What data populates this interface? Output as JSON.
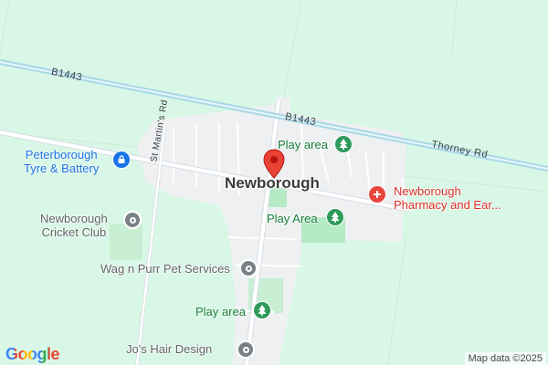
{
  "map": {
    "town_label": "Newborough",
    "roads": {
      "b1443_west": "B1443",
      "b1443_east": "B1443",
      "thorney_rd": "Thorney Rd",
      "st_martins_rd": "St Martin's Rd"
    },
    "pois": {
      "tyre": {
        "line1": "Peterborough",
        "line2": "Tyre & Battery",
        "icon": "lock-shop-icon"
      },
      "cricket": {
        "line1": "Newborough",
        "line2": "Cricket Club",
        "icon": "place-icon"
      },
      "pharmacy": {
        "line1": "Newborough",
        "line2": "Pharmacy and Ear...",
        "icon": "pharmacy-icon"
      },
      "play1": {
        "label": "Play area",
        "icon": "tree-icon"
      },
      "play2": {
        "label": "Play Area",
        "icon": "tree-icon"
      },
      "play3": {
        "label": "Play area",
        "icon": "tree-icon"
      },
      "wag": {
        "label": "Wag n Purr Pet Services",
        "icon": "place-icon"
      },
      "jos": {
        "label": "Jo's Hair Design",
        "icon": "place-icon"
      }
    },
    "colors": {
      "land": "#d9f7e6",
      "town": "#eef0f2",
      "park": "#b5eac5",
      "road_blue": "#a8d8e8",
      "poi_blue": "#1a73e8",
      "poi_red": "#d93025",
      "poi_green": "#188038"
    }
  },
  "logo": "Google",
  "attribution": "Map data ©2025"
}
